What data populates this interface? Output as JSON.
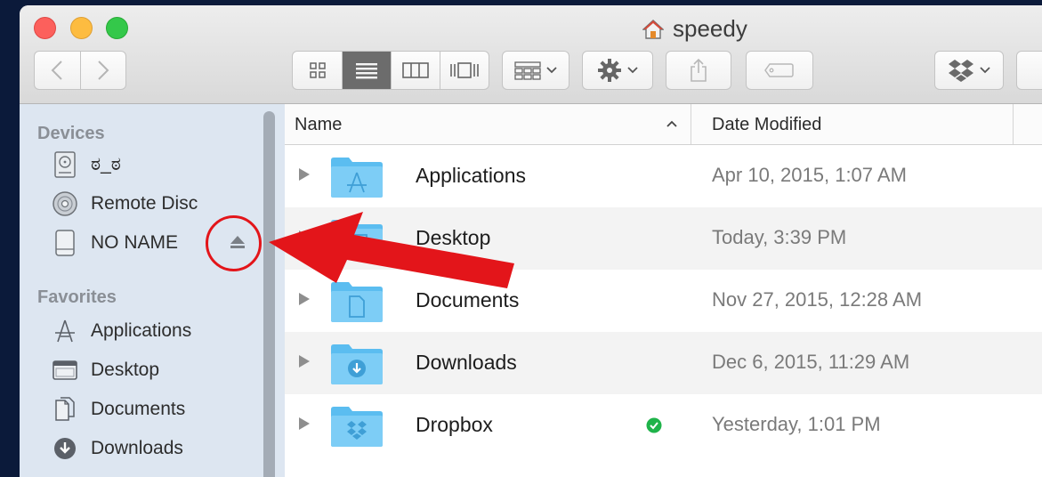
{
  "window": {
    "title": "speedy"
  },
  "toolbar": {
    "back_icon": "chevron-left-icon",
    "forward_icon": "chevron-right-icon",
    "views": [
      "icon-view-icon",
      "list-view-icon",
      "column-view-icon",
      "cover-flow-icon"
    ],
    "active_view": "list",
    "arrange_icon": "grid-arrange-icon",
    "action_icon": "gear-icon",
    "share_icon": "share-icon",
    "tag_icon": "tag-icon",
    "dropbox_icon": "dropbox-icon"
  },
  "sidebar": {
    "devices_heading": "Devices",
    "devices": [
      {
        "label": "ಠ_ಠ",
        "icon": "hard-drive-icon"
      },
      {
        "label": "Remote Disc",
        "icon": "disc-icon"
      },
      {
        "label": "NO NAME",
        "icon": "external-drive-icon",
        "ejectable": true
      }
    ],
    "favorites_heading": "Favorites",
    "favorites": [
      {
        "label": "Applications",
        "icon": "applications-icon"
      },
      {
        "label": "Desktop",
        "icon": "desktop-icon"
      },
      {
        "label": "Documents",
        "icon": "documents-icon"
      },
      {
        "label": "Downloads",
        "icon": "downloads-icon"
      }
    ]
  },
  "list": {
    "col_name": "Name",
    "col_date": "Date Modified",
    "sort_indicator": "^",
    "rows": [
      {
        "name": "Applications",
        "date": "Apr 10, 2015, 1:07 AM",
        "icon": "applications-folder-icon"
      },
      {
        "name": "Desktop",
        "date": "Today, 3:39 PM",
        "icon": "desktop-folder-icon"
      },
      {
        "name": "Documents",
        "date": "Nov 27, 2015, 12:28 AM",
        "icon": "documents-folder-icon"
      },
      {
        "name": "Downloads",
        "date": "Dec 6, 2015, 11:29 AM",
        "icon": "downloads-folder-icon"
      },
      {
        "name": "Dropbox",
        "date": "Yesterday, 1:01 PM",
        "icon": "dropbox-folder-icon",
        "synced": true
      }
    ]
  },
  "colors": {
    "sidebar_bg": "#dde6f1",
    "folder_blue": "#5bbdf0",
    "annotation_red": "#e3151a",
    "sync_green": "#1fb34a"
  }
}
